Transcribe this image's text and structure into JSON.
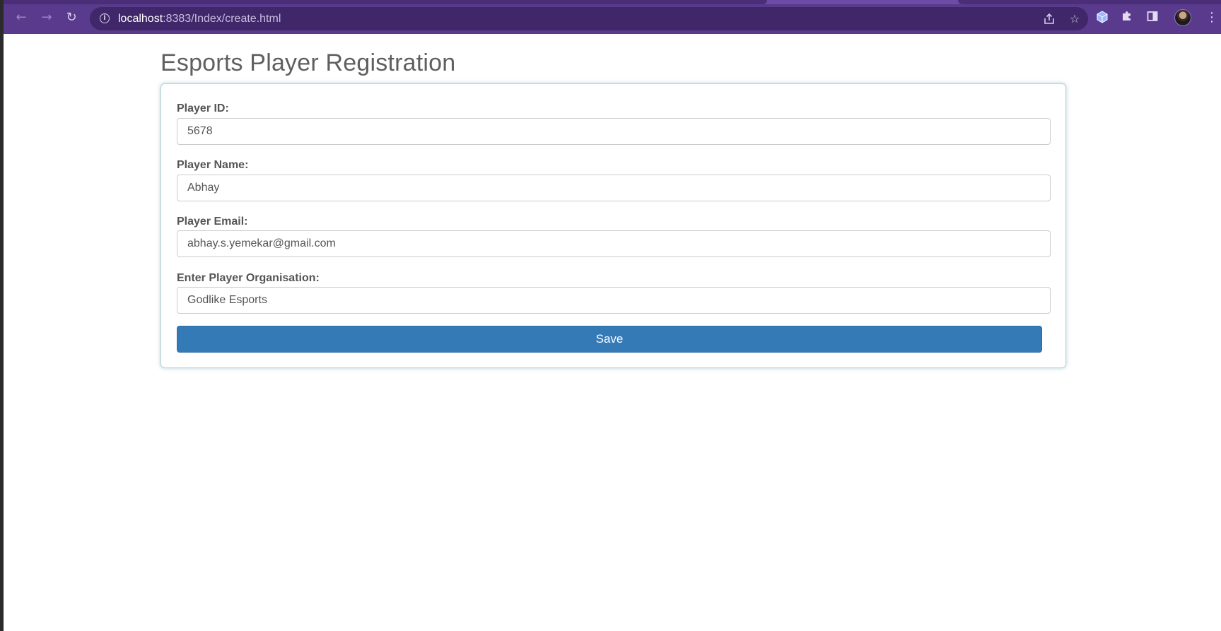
{
  "browser": {
    "url_host": "localhost",
    "url_path": ":8383/Index/create.html",
    "icons": {
      "back": "arrow-left-icon",
      "forward": "arrow-right-icon",
      "reload": "reload-icon",
      "site_info": "info-icon",
      "share": "share-icon",
      "bookmark": "star-icon",
      "extension": "cube-extension-icon",
      "extensions_menu": "puzzle-icon",
      "side_panel": "side-panel-icon",
      "profile": "avatar",
      "menu": "kebab-menu-icon"
    },
    "colors": {
      "frame": "#5a3a8c",
      "omnibox": "#3f2769"
    }
  },
  "page": {
    "title": "Esports Player Registration",
    "form": {
      "fields": [
        {
          "label": "Player ID:",
          "value": "5678"
        },
        {
          "label": "Player Name:",
          "value": "Abhay"
        },
        {
          "label": "Player Email:",
          "value": "abhay.s.yemekar@gmail.com"
        },
        {
          "label": "Enter Player Organisation:",
          "value": "Godlike Esports"
        }
      ],
      "submit_label": "Save"
    },
    "colors": {
      "button": "#337ab7",
      "title": "#5f5f5f"
    }
  }
}
